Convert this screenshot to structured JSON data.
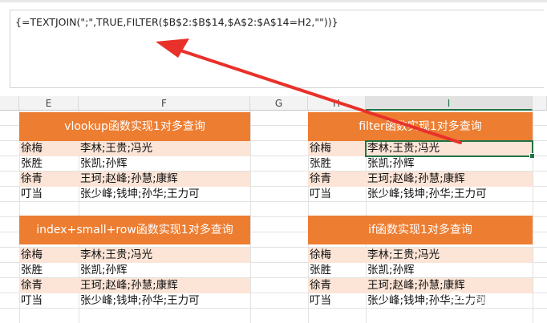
{
  "formula": "{=TEXTJOIN(\";\",TRUE,FILTER($B$2:$B$14,$A$2:$A$14=H2,\"\"))}",
  "columns": [
    "E",
    "F",
    "G",
    "H",
    "I"
  ],
  "tables": {
    "vlookup": {
      "title": "vlookup函数实现1对多查询"
    },
    "filter": {
      "title": "filter函数实现1对多查询"
    },
    "index": {
      "title": "index+small+row函数实现1对多查询"
    },
    "if": {
      "title": "if函数实现1对多查询"
    }
  },
  "rows": [
    {
      "name": "徐梅",
      "value": "李林;王贵;冯光"
    },
    {
      "name": "张胜",
      "value": "张凯;孙辉"
    },
    {
      "name": "徐青",
      "value": "王珂;赵峰;孙慧;康辉"
    },
    {
      "name": "叮当",
      "value": "张少峰;钱坤;孙华;王力可"
    }
  ],
  "watermark": "吴明课堂",
  "colors": {
    "header": "#ed7d31",
    "band": "#fce4d6",
    "selection": "#217346",
    "arrow": "#e8312a"
  }
}
